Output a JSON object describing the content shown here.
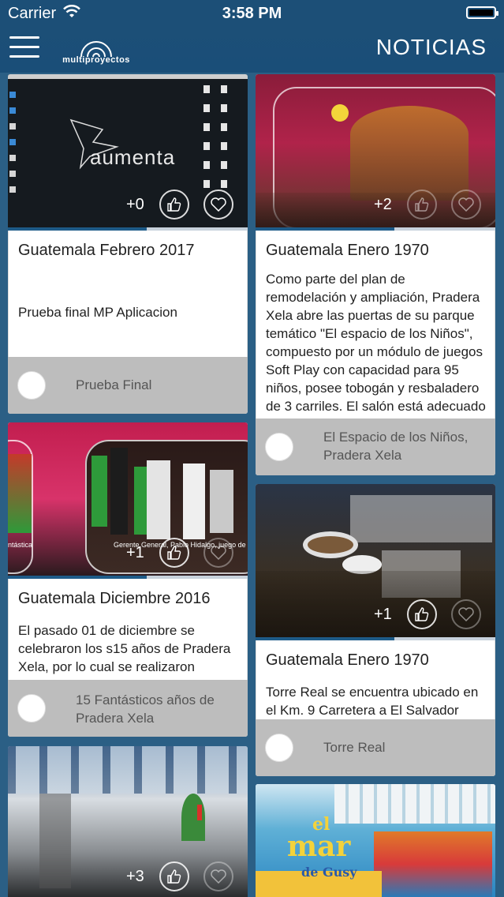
{
  "status_bar": {
    "carrier": "Carrier",
    "time": "3:58 PM"
  },
  "nav": {
    "logo_text": "multiproyectos",
    "title": "NOTICIAS"
  },
  "cards": [
    {
      "image_label": "aumenta",
      "count": "+0",
      "title": "Guatemala Febrero 2017",
      "text": "Prueba final MP Aplicacion",
      "footer": "Prueba Final",
      "progress": 0.58
    },
    {
      "count": "+2",
      "title": "Guatemala Enero 1970",
      "text": "Como parte del plan de remodelación y ampliación, Pradera Xela abre las puertas de su parque temático \"El espacio de los Niños\", compuesto por un módulo de juegos Soft Play con capacidad para 95 niños, posee tobogán y resbaladero de 3 carriles. El salón está adecuado con tema d…",
      "footer": "El Espacio de los Niños, Pradera Xela",
      "progress": 0.58
    },
    {
      "image_caption_left": "ntástica",
      "image_caption_right": "Gerente General, Pablo Hidalgo, juego de su",
      "count": "+1",
      "title": "Guatemala Diciembre 2016",
      "text": "El pasado 01 de diciembre se celebraron los s15 años de Pradera Xela, por lo cual se realizaron difere…",
      "footer": "15 Fantásticos años de Pradera Xela",
      "progress": 0.58
    },
    {
      "count": "+1",
      "title": "Guatemala Enero 1970",
      "text": "Torre Real se encuentra ubicado en el Km. 9 Carretera a El Salvador dentr…",
      "footer": "Torre Real",
      "progress": 0.58
    },
    {
      "count": "+3"
    },
    {
      "image_text_1": "el",
      "image_text_2": "mar",
      "image_text_3": "de Gusy"
    }
  ]
}
